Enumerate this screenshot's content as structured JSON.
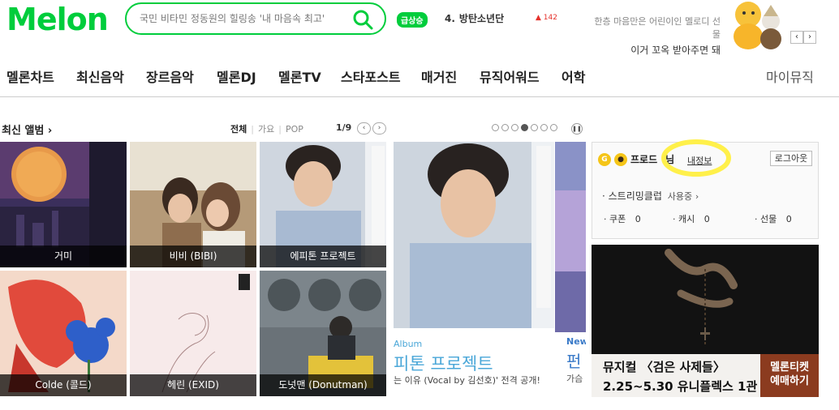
{
  "header": {
    "logo": "Melon",
    "search_placeholder": "국민 비타민 정동원의 힐링송 '내 마음속 최고'",
    "rise_badge": "급상승",
    "rank_number": "4.",
    "rank_artist": "방탄소년단",
    "rank_change": "142",
    "promo_line1": "한층 마음만은 어린이인 멜로디 선물",
    "promo_line2": "이거 꼬옥 받아주면 돼",
    "promo_prev": "‹",
    "promo_next": "›"
  },
  "gnb": {
    "items": [
      "멜론차트",
      "최신음악",
      "장르음악",
      "멜론DJ",
      "멜론TV",
      "스타포스트",
      "매거진",
      "뮤직어워드",
      "어학"
    ],
    "mymusic": "마이뮤직"
  },
  "albums": {
    "title": "최신 앨범",
    "filters": [
      "전체",
      "가요",
      "POP"
    ],
    "page": "1/9",
    "tiles": [
      {
        "caption": "거미"
      },
      {
        "caption": "비비 (BIBI)"
      },
      {
        "caption": "에피톤 프로젝트"
      },
      {
        "caption": "Colde (콜드)"
      },
      {
        "caption": "헤린 (EXID)"
      },
      {
        "caption": "도넛맨 (Donutman)"
      }
    ]
  },
  "feature": {
    "label": "Album",
    "title": "피톤 프로젝트",
    "desc": "는 이유 (Vocal by 김선호)' 전격 공개!",
    "side_label": "New",
    "side_title": "펀",
    "side_sub": "가슴"
  },
  "login": {
    "user_name": "프로드",
    "user_suffix": "님",
    "my_info": "내정보",
    "logout": "로그아웃",
    "streaming": "스트리밍클럽",
    "streaming_status": "사용중",
    "coupon_label": "쿠폰",
    "coupon_count": "0",
    "cash_label": "캐시",
    "cash_count": "0",
    "gift_label": "선물",
    "gift_count": "0"
  },
  "ad": {
    "line1": "뮤지컬 〈검은 사제들〉",
    "line2": "2.25~5.30 유니플렉스 1관",
    "tag1": "멜론티켓",
    "tag2": "예매하기"
  },
  "colors": {
    "brand": "#00cd3c",
    "highlight": "#fff04a",
    "rank_up": "#e5312b"
  }
}
